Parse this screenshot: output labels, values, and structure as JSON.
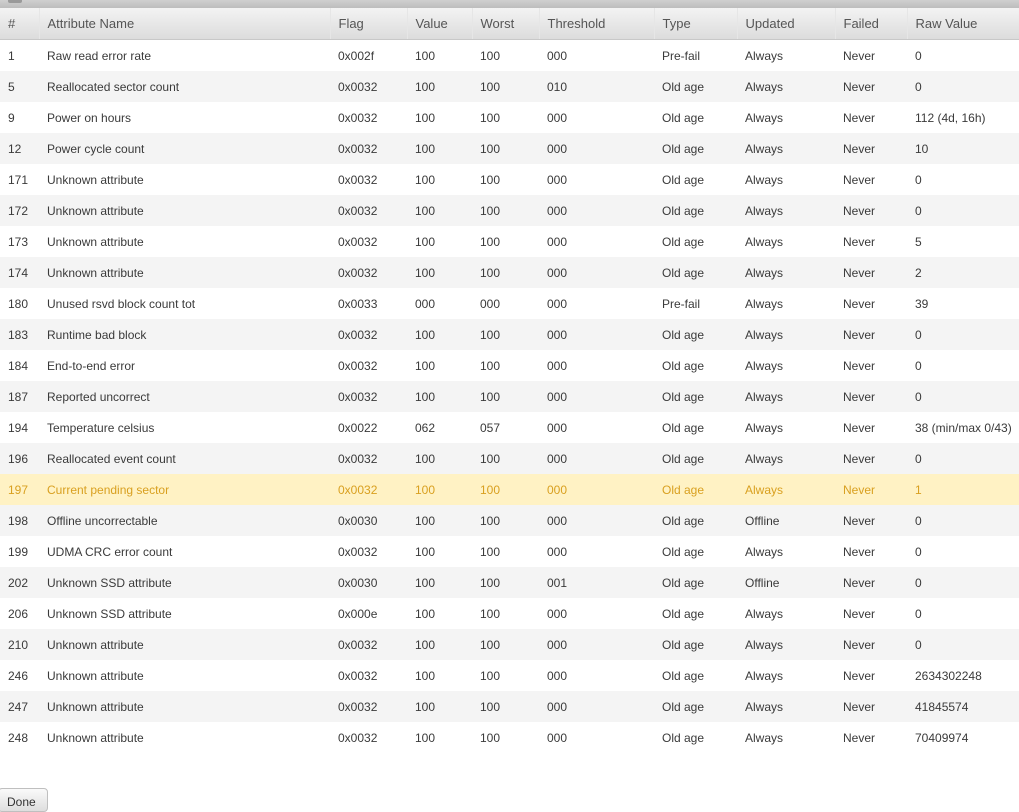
{
  "table": {
    "headers": [
      "#",
      "Attribute Name",
      "Flag",
      "Value",
      "Worst",
      "Threshold",
      "Type",
      "Updated",
      "Failed",
      "Raw Value"
    ],
    "rows": [
      [
        "1",
        "Raw read error rate",
        "0x002f",
        "100",
        "100",
        "000",
        "Pre-fail",
        "Always",
        "Never",
        "0"
      ],
      [
        "5",
        "Reallocated sector count",
        "0x0032",
        "100",
        "100",
        "010",
        "Old age",
        "Always",
        "Never",
        "0"
      ],
      [
        "9",
        "Power on hours",
        "0x0032",
        "100",
        "100",
        "000",
        "Old age",
        "Always",
        "Never",
        "112 (4d, 16h)"
      ],
      [
        "12",
        "Power cycle count",
        "0x0032",
        "100",
        "100",
        "000",
        "Old age",
        "Always",
        "Never",
        "10"
      ],
      [
        "171",
        "Unknown attribute",
        "0x0032",
        "100",
        "100",
        "000",
        "Old age",
        "Always",
        "Never",
        "0"
      ],
      [
        "172",
        "Unknown attribute",
        "0x0032",
        "100",
        "100",
        "000",
        "Old age",
        "Always",
        "Never",
        "0"
      ],
      [
        "173",
        "Unknown attribute",
        "0x0032",
        "100",
        "100",
        "000",
        "Old age",
        "Always",
        "Never",
        "5"
      ],
      [
        "174",
        "Unknown attribute",
        "0x0032",
        "100",
        "100",
        "000",
        "Old age",
        "Always",
        "Never",
        "2"
      ],
      [
        "180",
        "Unused rsvd block count tot",
        "0x0033",
        "000",
        "000",
        "000",
        "Pre-fail",
        "Always",
        "Never",
        "39"
      ],
      [
        "183",
        "Runtime bad block",
        "0x0032",
        "100",
        "100",
        "000",
        "Old age",
        "Always",
        "Never",
        "0"
      ],
      [
        "184",
        "End-to-end error",
        "0x0032",
        "100",
        "100",
        "000",
        "Old age",
        "Always",
        "Never",
        "0"
      ],
      [
        "187",
        "Reported uncorrect",
        "0x0032",
        "100",
        "100",
        "000",
        "Old age",
        "Always",
        "Never",
        "0"
      ],
      [
        "194",
        "Temperature celsius",
        "0x0022",
        "062",
        "057",
        "000",
        "Old age",
        "Always",
        "Never",
        "38 (min/max 0/43)"
      ],
      [
        "196",
        "Reallocated event count",
        "0x0032",
        "100",
        "100",
        "000",
        "Old age",
        "Always",
        "Never",
        "0"
      ],
      [
        "197",
        "Current pending sector",
        "0x0032",
        "100",
        "100",
        "000",
        "Old age",
        "Always",
        "Never",
        "1"
      ],
      [
        "198",
        "Offline uncorrectable",
        "0x0030",
        "100",
        "100",
        "000",
        "Old age",
        "Offline",
        "Never",
        "0"
      ],
      [
        "199",
        "UDMA CRC error count",
        "0x0032",
        "100",
        "100",
        "000",
        "Old age",
        "Always",
        "Never",
        "0"
      ],
      [
        "202",
        "Unknown SSD attribute",
        "0x0030",
        "100",
        "100",
        "001",
        "Old age",
        "Offline",
        "Never",
        "0"
      ],
      [
        "206",
        "Unknown SSD attribute",
        "0x000e",
        "100",
        "100",
        "000",
        "Old age",
        "Always",
        "Never",
        "0"
      ],
      [
        "210",
        "Unknown attribute",
        "0x0032",
        "100",
        "100",
        "000",
        "Old age",
        "Always",
        "Never",
        "0"
      ],
      [
        "246",
        "Unknown attribute",
        "0x0032",
        "100",
        "100",
        "000",
        "Old age",
        "Always",
        "Never",
        "2634302248"
      ],
      [
        "247",
        "Unknown attribute",
        "0x0032",
        "100",
        "100",
        "000",
        "Old age",
        "Always",
        "Never",
        "41845574"
      ],
      [
        "248",
        "Unknown attribute",
        "0x0032",
        "100",
        "100",
        "000",
        "Old age",
        "Always",
        "Never",
        "70409974"
      ]
    ],
    "highlighted_row_id": "197"
  },
  "colors": {
    "highlight_background": "#fff2c4",
    "highlight_text": "#d9a020",
    "header_background": "#e4e4e4",
    "stripe_background": "#f4f4f4"
  },
  "footer": {
    "done_label": "Done"
  }
}
